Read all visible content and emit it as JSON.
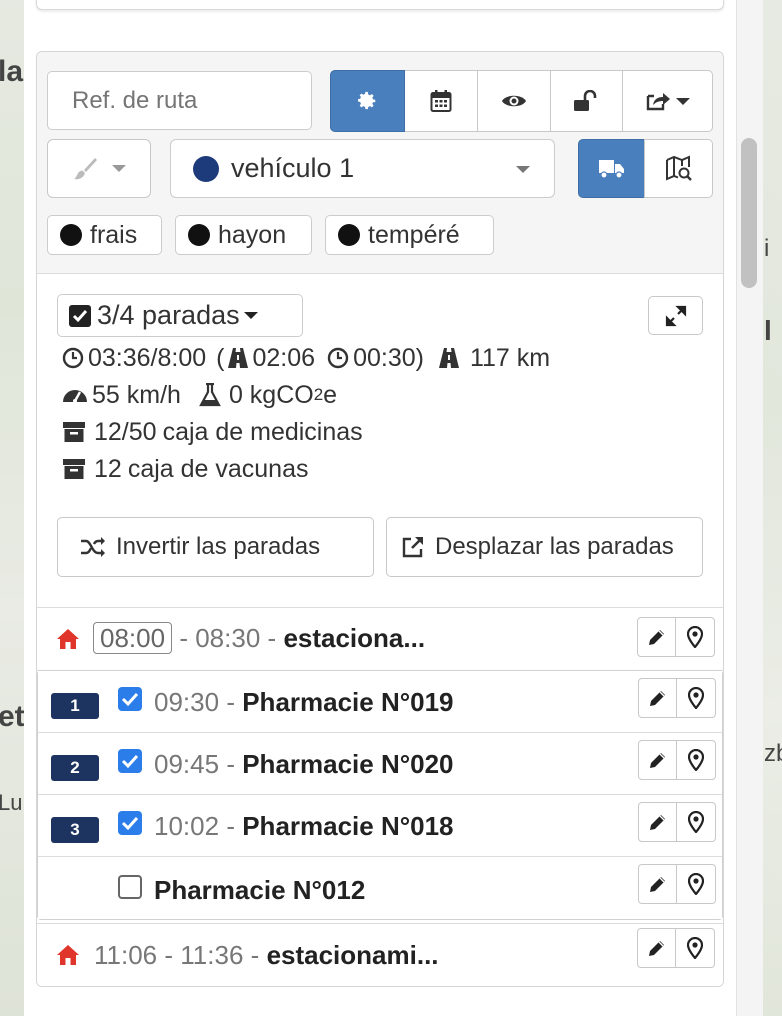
{
  "colors": {
    "primary_active": "#4a7fbd",
    "vehicle_dot": "#1d3a7a",
    "number_badge": "#1d3461",
    "checkbox_checked": "#2b7de9",
    "home_icon": "#e0352b"
  },
  "map": {
    "left_labels": [
      "la",
      "et",
      "Lu"
    ],
    "right_labels": [
      "i",
      "l",
      "zb"
    ]
  },
  "route": {
    "ref_placeholder": "Ref. de ruta",
    "toolbar_icons": [
      "gear-icon",
      "calendar-icon",
      "eye-icon",
      "unlock-icon",
      "share-icon"
    ],
    "vehicle": "vehículo 1",
    "tags": [
      "frais",
      "hayon",
      "tempéré"
    ],
    "stops_summary": "3/4 paradas",
    "stats": {
      "time_total": "03:36/8:00",
      "open_paren": "(",
      "drive_time": "02:06",
      "service_time": "00:30)",
      "distance": "117 km",
      "speed": "55 km/h",
      "co2_prefix": "0 kgCO",
      "co2_sub": "2",
      "co2_suffix": "e",
      "qty_medicines_num": "12/50",
      "qty_medicines_label": "caja de medicinas",
      "qty_vaccines_num": "12",
      "qty_vaccines_label": "caja de vacunas"
    },
    "actions": {
      "reverse": "Invertir las paradas",
      "move": "Desplazar las paradas"
    },
    "start": {
      "time_from": "08:00",
      "sep1": "-",
      "time_to": "08:30",
      "sep2": "-",
      "name": "estaciona..."
    },
    "stops": [
      {
        "number": "1",
        "time": "09:30",
        "sep": "-",
        "name": "Pharmacie N°019",
        "checked": true
      },
      {
        "number": "2",
        "time": "09:45",
        "sep": "-",
        "name": "Pharmacie N°020",
        "checked": true
      },
      {
        "number": "3",
        "time": "10:02",
        "sep": "-",
        "name": "Pharmacie N°018",
        "checked": true
      },
      {
        "number": "",
        "time": "",
        "sep": "",
        "name": "Pharmacie N°012",
        "checked": false
      }
    ],
    "end": {
      "time_from": "11:06",
      "sep1": "-",
      "time_to": "11:36",
      "sep2": "-",
      "name": "estacionami..."
    }
  }
}
